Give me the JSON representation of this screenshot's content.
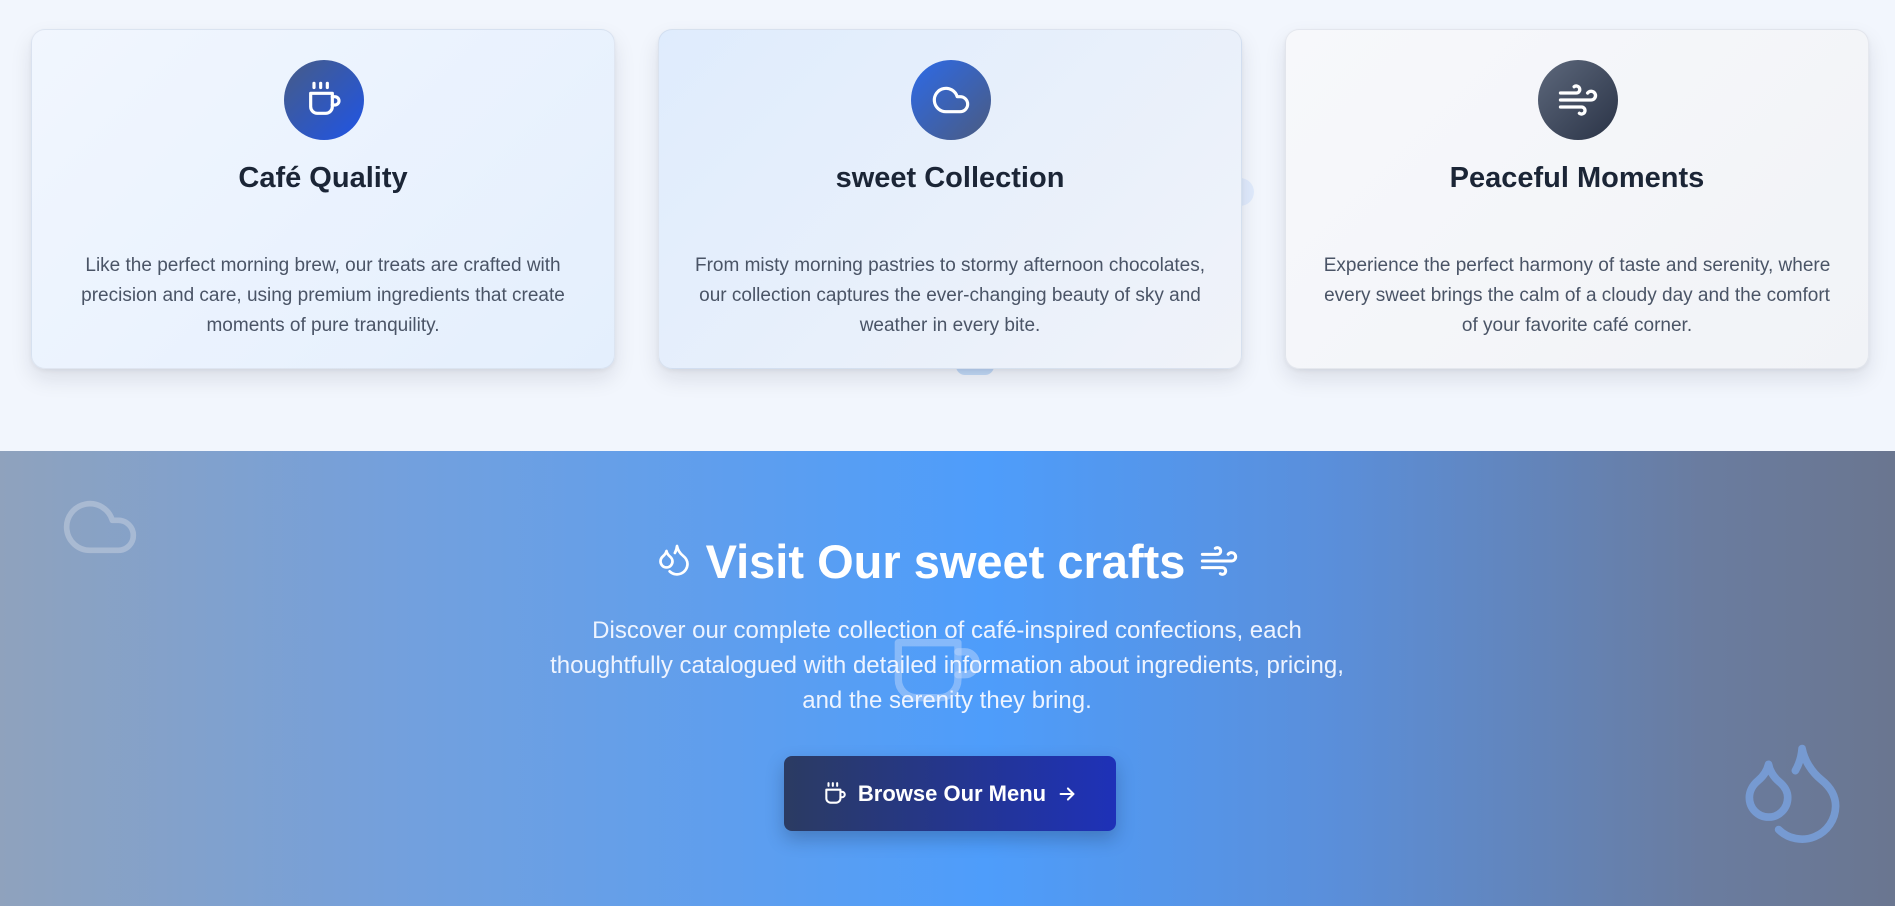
{
  "features": {
    "cards": [
      {
        "icon": "coffee-cup-icon",
        "title": "Café Quality",
        "description": "Like the perfect morning brew, our treats are crafted with precision and care, using premium ingredients that create moments of pure tranquility."
      },
      {
        "icon": "cloud-icon",
        "title": "sweet Collection",
        "description": "From misty morning pastries to stormy afternoon chocolates, our collection captures the ever-changing beauty of sky and weather in every bite."
      },
      {
        "icon": "wind-icon",
        "title": "Peaceful Moments",
        "description": "Experience the perfect harmony of taste and serenity, where every sweet brings the calm of a cloudy day and the comfort of your favorite café corner."
      }
    ]
  },
  "cta": {
    "title": "Visit Our sweet crafts",
    "title_left_icon": "droplets-icon",
    "title_right_icon": "wind-icon",
    "description": "Discover our complete collection of café-inspired confections, each thoughtfully catalogued with detailed information about ingredients, pricing, and the serenity they bring.",
    "button": {
      "label": "Browse Our Menu",
      "left_icon": "coffee-cup-icon",
      "right_icon": "arrow-right-icon"
    }
  },
  "colors": {
    "page_background": "#f2f6fd",
    "heading_text": "#1b2536",
    "body_text": "#4a5466",
    "cta_accent": "#4e9dfb",
    "button_start": "#2b3b62",
    "button_end": "#1e31b8"
  }
}
